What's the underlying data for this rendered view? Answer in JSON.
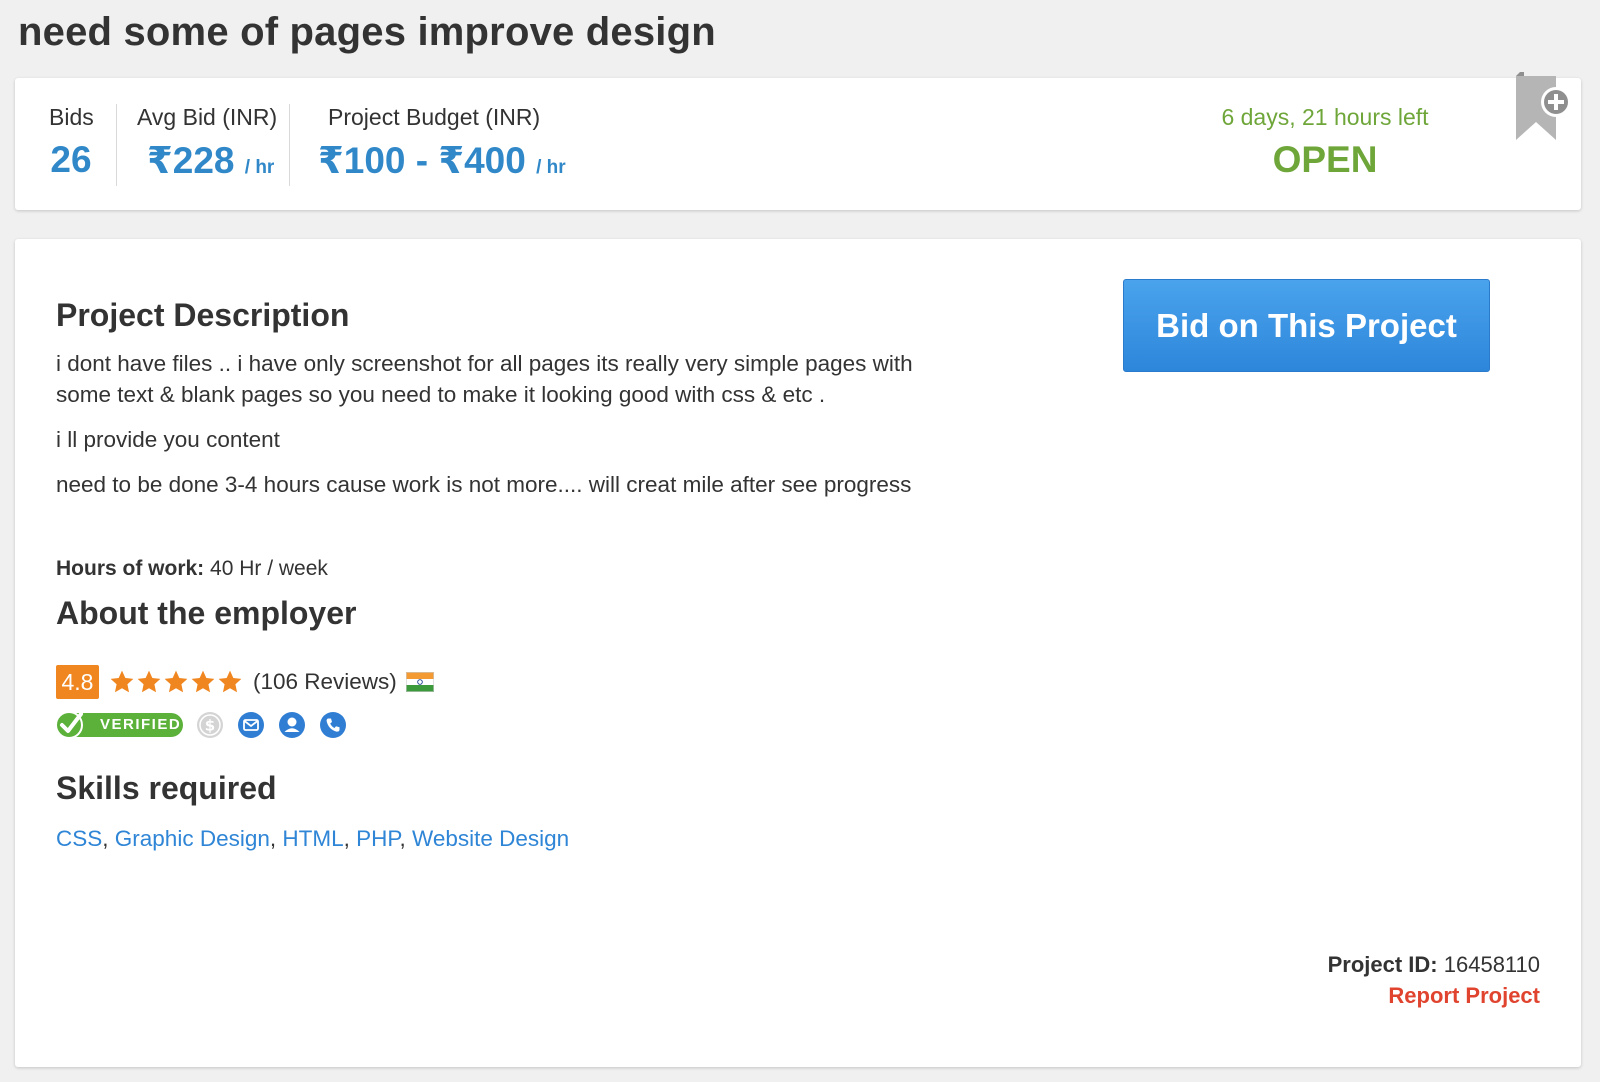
{
  "page": {
    "title": "need some of pages improve design"
  },
  "stats": {
    "bids": {
      "label": "Bids",
      "value": "26"
    },
    "avg_bid": {
      "label": "Avg Bid (INR)",
      "value": "₹228",
      "unit": "/ hr"
    },
    "budget": {
      "label": "Project Budget (INR)",
      "value": "₹100 - ₹400",
      "unit": "/ hr"
    },
    "time_left": "6 days, 21 hours left",
    "status": "OPEN",
    "bookmark_icon": "bookmark-add-icon"
  },
  "bid_button": {
    "label": "Bid on This Project"
  },
  "description": {
    "heading": "Project Description",
    "paragraphs": [
      "i dont have files .. i have only screenshot for all pages its really very simple pages with some text & blank pages so you need to make it looking good with css & etc .",
      "i ll provide you content",
      "need to be done 3-4 hours cause work is not more.... will creat mile after see progress"
    ],
    "hours_label": "Hours of work:",
    "hours_value": "40 Hr / week"
  },
  "employer": {
    "heading": "About the employer",
    "rating": "4.8",
    "star_count": 5,
    "reviews": "(106 Reviews)",
    "country_flag": "india-flag-icon",
    "verified_label": "VERIFIED",
    "verification_icons": [
      "payment-verified-icon",
      "email-verified-icon",
      "profile-verified-icon",
      "phone-verified-icon"
    ]
  },
  "skills": {
    "heading": "Skills required",
    "items": [
      "CSS",
      "Graphic Design",
      "HTML",
      "PHP",
      "Website Design"
    ]
  },
  "footer": {
    "project_id_label": "Project ID:",
    "project_id_value": "16458110",
    "report_label": "Report Project"
  },
  "colors": {
    "accent_blue": "#3088c9",
    "link_blue": "#2f85d6",
    "open_green": "#6fa63a",
    "rating_orange": "#f0861f",
    "star_orange": "#f0861f",
    "verified_green": "#5bb13a",
    "report_red": "#e0442f",
    "button_blue": "#2e86db"
  }
}
